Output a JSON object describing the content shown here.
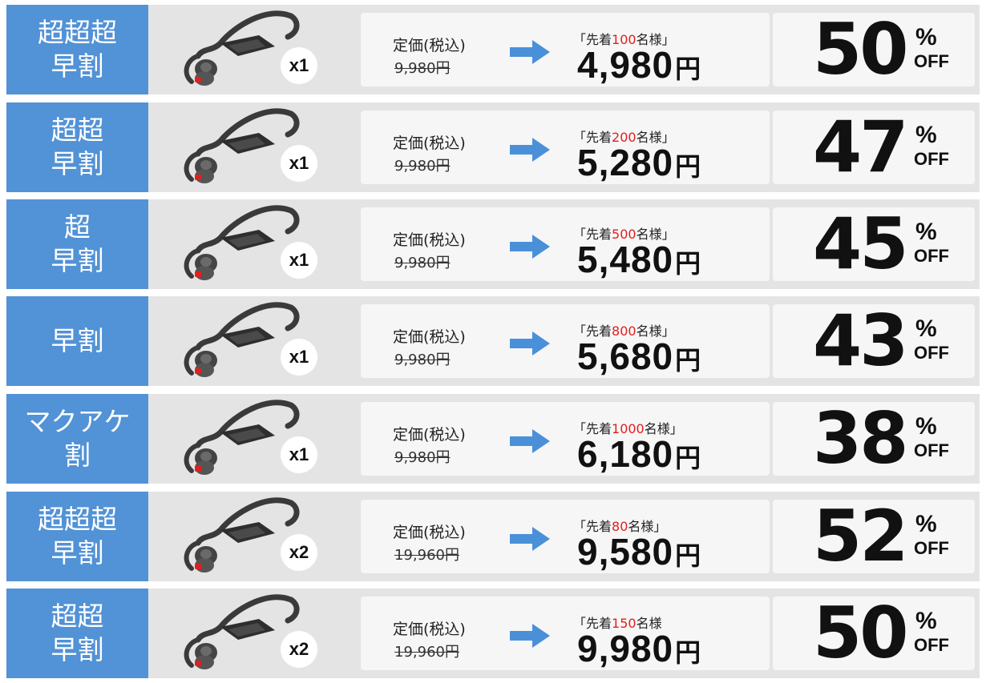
{
  "rows": [
    {
      "tier": "超超超\n早割",
      "qty": "x1",
      "reg_label": "定価(税込)",
      "reg_price": "9,980円",
      "first_pre": "「先着",
      "first_num": "100",
      "first_post": "名様」",
      "sale": "4,980",
      "yen": "円",
      "pct": "50",
      "psign": "%",
      "off": "OFF"
    },
    {
      "tier": "超超\n早割",
      "qty": "x1",
      "reg_label": "定価(税込)",
      "reg_price": "9,980円",
      "first_pre": "「先着",
      "first_num": "200",
      "first_post": "名様」",
      "sale": "5,280",
      "yen": "円",
      "pct": "47",
      "psign": "%",
      "off": "OFF"
    },
    {
      "tier": "超\n早割",
      "qty": "x1",
      "reg_label": "定価(税込)",
      "reg_price": "9,980円",
      "first_pre": "「先着",
      "first_num": "500",
      "first_post": "名様」",
      "sale": "5,480",
      "yen": "円",
      "pct": "45",
      "psign": "%",
      "off": "OFF"
    },
    {
      "tier": "早割",
      "qty": "x1",
      "reg_label": "定価(税込)",
      "reg_price": "9,980円",
      "first_pre": "「先着",
      "first_num": "800",
      "first_post": "名様」",
      "sale": "5,680",
      "yen": "円",
      "pct": "43",
      "psign": "%",
      "off": "OFF"
    },
    {
      "tier": "マクアケ\n割",
      "qty": "x1",
      "reg_label": "定価(税込)",
      "reg_price": "9,980円",
      "first_pre": "「先着",
      "first_num": "1000",
      "first_post": "名様」",
      "sale": "6,180",
      "yen": "円",
      "pct": "38",
      "psign": "%",
      "off": "OFF"
    },
    {
      "tier": "超超超\n早割",
      "qty": "x2",
      "reg_label": "定価(税込)",
      "reg_price": "19,960円",
      "first_pre": "「先着",
      "first_num": "80",
      "first_post": "名様」",
      "sale": "9,580",
      "yen": "円",
      "pct": "52",
      "psign": "%",
      "off": "OFF"
    },
    {
      "tier": "超超\n早割",
      "qty": "x2",
      "reg_label": "定価(税込)",
      "reg_price": "19,960円",
      "first_pre": "「先着",
      "first_num": "150",
      "first_post": "名様",
      "sale": "9,980",
      "yen": "円",
      "pct": "50",
      "psign": "%",
      "off": "OFF"
    }
  ],
  "colors": {
    "tier_bg": "#5292d6",
    "accent_red": "#e0201f",
    "arrow": "#4a90d9"
  },
  "icons": {
    "product": "earbud-headphones-icon",
    "arrow": "arrow-right-icon"
  }
}
